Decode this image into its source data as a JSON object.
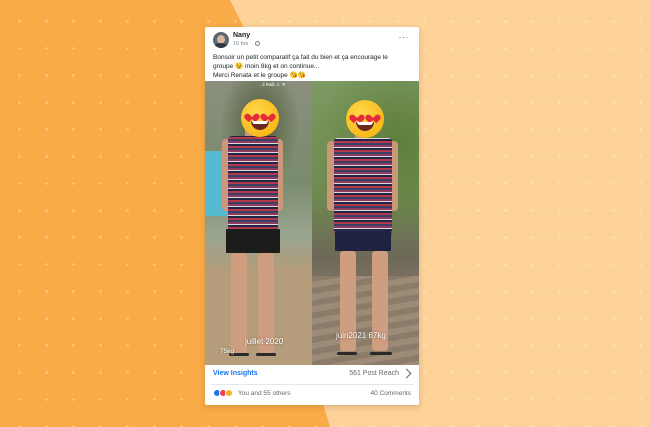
{
  "post": {
    "author": "Nany",
    "timestamp": "16 hrs",
    "caption_lines": [
      "Bonsoir un petit comparatif ça fait du bien et ça encourage le",
      "groupe 😉 moin 8kg et on continue...",
      "Merci Renata et le groupe 😘😘"
    ],
    "photo": {
      "status_bar": "..il Ralli ☺ ᯤ",
      "left_label": "juillet 2020",
      "left_weight": "75kg",
      "right_label": "juin2021 67kg"
    },
    "footer": {
      "insights_label": "View Insights",
      "reach_label": "561 Post Reach",
      "reactions_text": "You and 55 others",
      "comments_text": "40 Comments"
    }
  },
  "colors": {
    "background_dark": "#f9ab48",
    "background_light": "#fdd39a",
    "link": "#1877f2"
  },
  "icons": [
    "avatar",
    "globe-icon",
    "more-options-icon",
    "heart-eyes-emoji",
    "chevron-right-icon",
    "like-icon",
    "love-icon",
    "haha-icon"
  ]
}
